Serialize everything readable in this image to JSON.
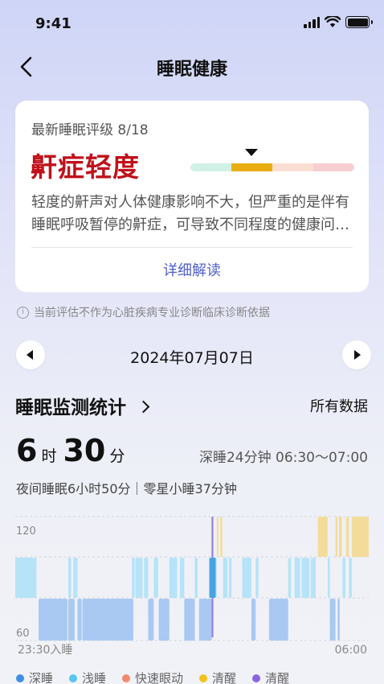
{
  "status_bar": {
    "time": "9:41"
  },
  "nav": {
    "title": "睡眠健康"
  },
  "rating": {
    "date_label": "最新睡眠评级 8/18",
    "level": "鼾症轻度",
    "scale_colors": [
      "#d2f1e6",
      "#e9ad12",
      "#fbded3",
      "#f7cfd1"
    ],
    "level_index": 1,
    "description": "轻度的鼾声对人体健康影响不大，但严重的是伴有睡眠呼吸暂停的鼾症，可导致不同程度的健康问题。",
    "detail_link": "详细解读"
  },
  "disclaimer": "当前评估不作为心脏疾病专业诊断临床诊断依据",
  "date_nav": {
    "date": "2024年07月07日"
  },
  "stats": {
    "title": "睡眠监测统计",
    "all_data": "所有数据",
    "hours": "6",
    "hours_unit": "时",
    "minutes": "30",
    "minutes_unit": "分",
    "deep_sleep_info": "深睡24分钟  06:30～07:00",
    "night_info": "夜间睡眠6小时50分｜零星小睡37分钟"
  },
  "chart_data": {
    "type": "sleep-stage-timeline",
    "y_tick_top": "120",
    "y_tick_bottom": "60",
    "x_start_label": "23:30入睡",
    "x_end_label": "06:00",
    "colors": {
      "deep": "#a9c9f2",
      "light": "#b6e3f8",
      "rem": "#f3a58a",
      "awake": "#f3dc9a",
      "marker": "#9079e6",
      "marker_core": "#49a4de"
    },
    "segments": [
      {
        "stage": "light",
        "start": 0.0,
        "end": 0.06
      },
      {
        "stage": "deep",
        "start": 0.066,
        "end": 0.148
      },
      {
        "stage": "deep",
        "start": 0.15,
        "end": 0.168
      },
      {
        "stage": "light",
        "start": 0.15,
        "end": 0.158
      },
      {
        "stage": "light",
        "start": 0.164,
        "end": 0.176
      },
      {
        "stage": "deep",
        "start": 0.176,
        "end": 0.188
      },
      {
        "stage": "deep",
        "start": 0.19,
        "end": 0.334
      },
      {
        "stage": "light",
        "start": 0.33,
        "end": 0.338
      },
      {
        "stage": "light",
        "start": 0.34,
        "end": 0.36
      },
      {
        "stage": "light",
        "start": 0.364,
        "end": 0.376
      },
      {
        "stage": "deep",
        "start": 0.376,
        "end": 0.392
      },
      {
        "stage": "light",
        "start": 0.392,
        "end": 0.404
      },
      {
        "stage": "deep",
        "start": 0.406,
        "end": 0.436
      },
      {
        "stage": "light",
        "start": 0.436,
        "end": 0.458
      },
      {
        "stage": "light",
        "start": 0.466,
        "end": 0.478
      },
      {
        "stage": "deep",
        "start": 0.478,
        "end": 0.508
      },
      {
        "stage": "light",
        "start": 0.508,
        "end": 0.516
      },
      {
        "stage": "deep",
        "start": 0.52,
        "end": 0.556
      },
      {
        "stage": "awake",
        "start": 0.554,
        "end": 0.56
      },
      {
        "stage": "light",
        "start": 0.558,
        "end": 0.57
      },
      {
        "stage": "awake",
        "start": 0.57,
        "end": 0.574
      },
      {
        "stage": "awake",
        "start": 0.58,
        "end": 0.586
      },
      {
        "stage": "light",
        "start": 0.588,
        "end": 0.6
      },
      {
        "stage": "light",
        "start": 0.604,
        "end": 0.612
      },
      {
        "stage": "light",
        "start": 0.642,
        "end": 0.668
      },
      {
        "stage": "deep",
        "start": 0.668,
        "end": 0.68
      },
      {
        "stage": "light",
        "start": 0.68,
        "end": 0.688
      },
      {
        "stage": "deep",
        "start": 0.718,
        "end": 0.772
      },
      {
        "stage": "light",
        "start": 0.772,
        "end": 0.78
      },
      {
        "stage": "light",
        "start": 0.79,
        "end": 0.806
      },
      {
        "stage": "light",
        "start": 0.81,
        "end": 0.832
      },
      {
        "stage": "light",
        "start": 0.836,
        "end": 0.85
      },
      {
        "stage": "awake",
        "start": 0.856,
        "end": 0.884
      },
      {
        "stage": "light",
        "start": 0.884,
        "end": 0.89
      },
      {
        "stage": "deep",
        "start": 0.89,
        "end": 0.906
      },
      {
        "stage": "awake",
        "start": 0.906,
        "end": 0.912
      },
      {
        "stage": "deep",
        "start": 0.912,
        "end": 0.918
      },
      {
        "stage": "awake",
        "start": 0.916,
        "end": 0.924
      },
      {
        "stage": "light",
        "start": 0.926,
        "end": 0.934
      },
      {
        "stage": "awake",
        "start": 0.936,
        "end": 0.944
      },
      {
        "stage": "light",
        "start": 0.944,
        "end": 0.952
      },
      {
        "stage": "awake",
        "start": 0.952,
        "end": 1.0
      }
    ],
    "markers": [
      {
        "position": 0.558
      }
    ]
  },
  "legend": [
    {
      "label": "深睡",
      "color": "#3f8ee6"
    },
    {
      "label": "浅睡",
      "color": "#56c5f0"
    },
    {
      "label": "快速眼动",
      "color": "#f08a6c"
    },
    {
      "label": "清醒",
      "color": "#f4c21b"
    },
    {
      "label": "清醒",
      "color": "#8a64e0"
    }
  ]
}
